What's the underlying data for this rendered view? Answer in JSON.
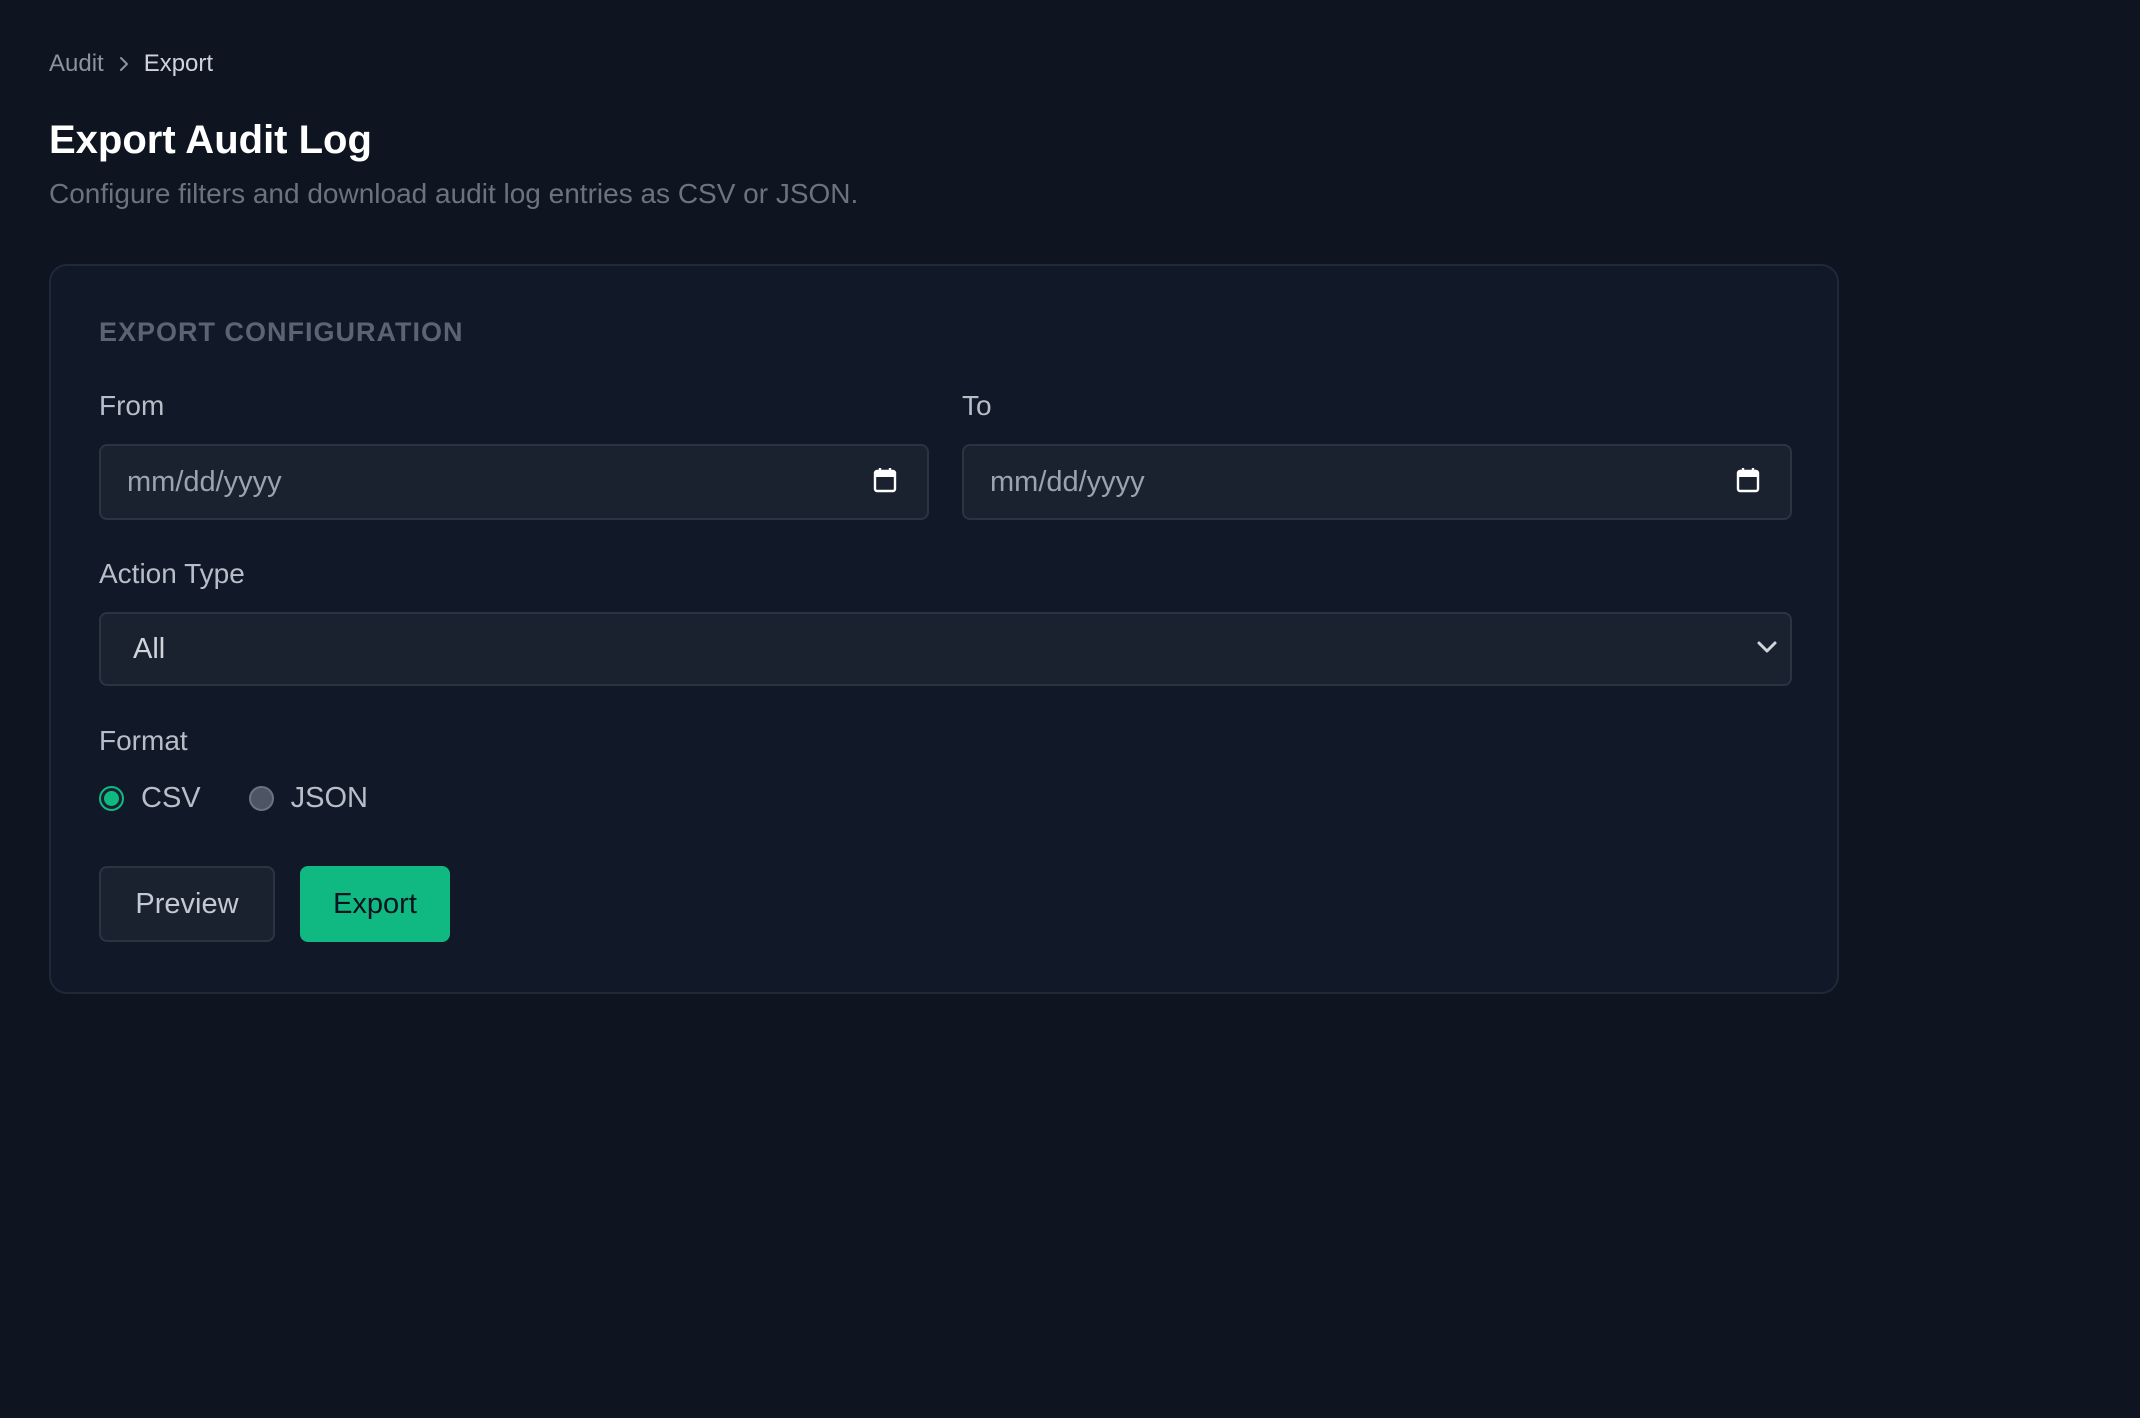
{
  "breadcrumb": {
    "parent": "Audit",
    "current": "Export"
  },
  "header": {
    "title": "Export Audit Log",
    "subtitle": "Configure filters and download audit log entries as CSV or JSON."
  },
  "card": {
    "section_title": "EXPORT CONFIGURATION",
    "from": {
      "label": "From",
      "placeholder": "mm/dd/yyyy"
    },
    "to": {
      "label": "To",
      "placeholder": "mm/dd/yyyy"
    },
    "action_type": {
      "label": "Action Type",
      "value": "All"
    },
    "format": {
      "label": "Format",
      "options": [
        {
          "label": "CSV",
          "checked": true
        },
        {
          "label": "JSON",
          "checked": false
        }
      ]
    },
    "buttons": {
      "preview": "Preview",
      "export": "Export"
    }
  },
  "colors": {
    "background": "#0e1521",
    "card": "#111827",
    "accent": "#10b981"
  },
  "icons": {
    "breadcrumb_separator": "chevron-right-icon",
    "date_picker": "calendar-icon",
    "select": "chevron-down-icon"
  }
}
